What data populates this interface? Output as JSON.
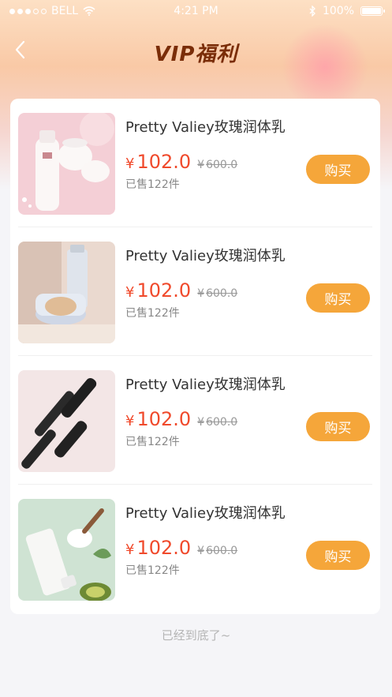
{
  "status_bar": {
    "carrier": "BELL",
    "time": "4:21 PM",
    "battery": "100%"
  },
  "nav": {
    "title": "VIP福利"
  },
  "products": [
    {
      "name": "Pretty Valiey玫瑰润体乳",
      "currency": "¥",
      "price": "102.0",
      "old_price": "600.0",
      "sold": "已售122件",
      "buy_label": "购买"
    },
    {
      "name": "Pretty Valiey玫瑰润体乳",
      "currency": "¥",
      "price": "102.0",
      "old_price": "600.0",
      "sold": "已售122件",
      "buy_label": "购买"
    },
    {
      "name": "Pretty Valiey玫瑰润体乳",
      "currency": "¥",
      "price": "102.0",
      "old_price": "600.0",
      "sold": "已售122件",
      "buy_label": "购买"
    },
    {
      "name": "Pretty Valiey玫瑰润体乳",
      "currency": "¥",
      "price": "102.0",
      "old_price": "600.0",
      "sold": "已售122件",
      "buy_label": "购买"
    }
  ],
  "footer": {
    "text": "已经到底了~"
  },
  "colors": {
    "accent": "#f5a63a",
    "price": "#f04a2c",
    "title": "#7a2d08"
  }
}
